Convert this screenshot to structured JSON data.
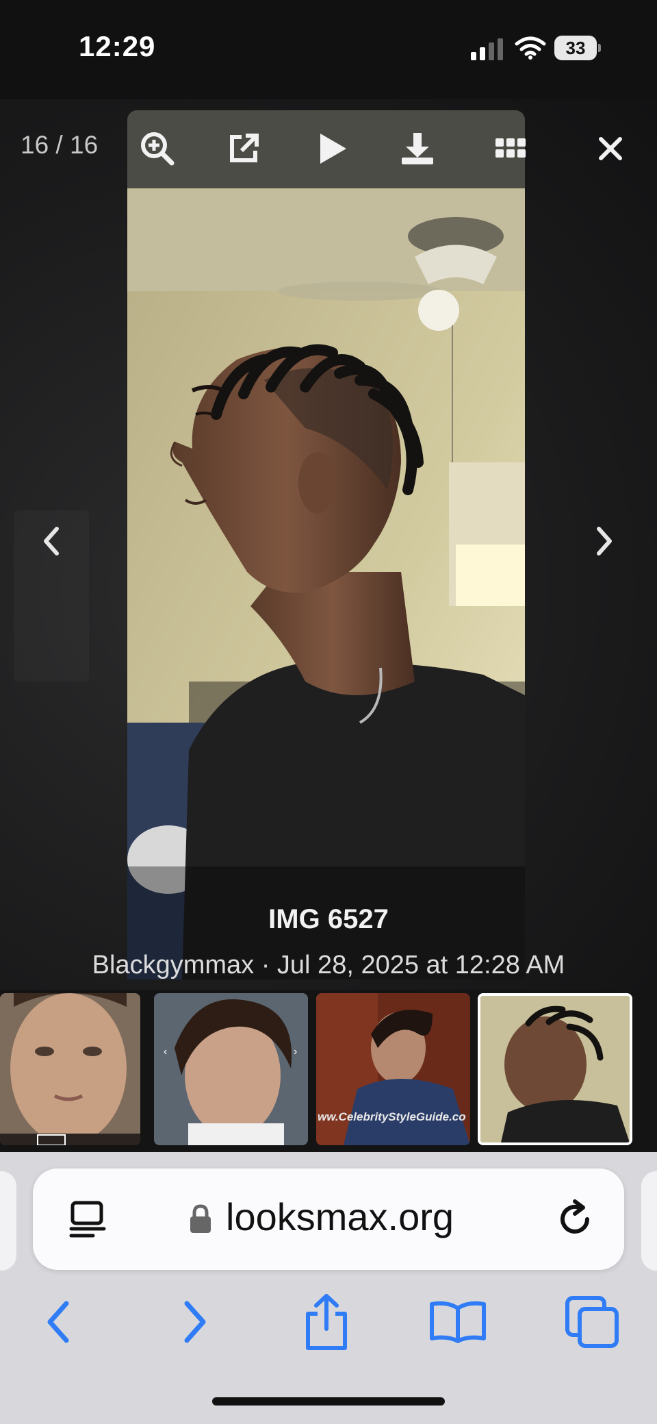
{
  "status_bar": {
    "time": "12:29",
    "battery_level": "33"
  },
  "lightbox": {
    "counter": "16 / 16",
    "toolbar": [
      "zoom-in-icon",
      "open-external-icon",
      "play-icon",
      "download-icon",
      "grid-icon"
    ],
    "caption_title": "IMG 6527",
    "caption_meta": "Blackgymmax · Jul 28, 2025 at 12:28 AM"
  },
  "thumbnails": [
    {
      "name": "thumb-1",
      "selected": false
    },
    {
      "name": "thumb-2",
      "selected": false
    },
    {
      "name": "thumb-3",
      "watermark": "ww.CelebrityStyleGuide.co",
      "selected": false
    },
    {
      "name": "thumb-4",
      "selected": true
    }
  ],
  "browser": {
    "url": "looksmax.org",
    "accent_color": "#2f7cf6",
    "nav": [
      "back-icon",
      "forward-icon",
      "share-icon",
      "bookmarks-icon",
      "tabs-icon"
    ]
  }
}
